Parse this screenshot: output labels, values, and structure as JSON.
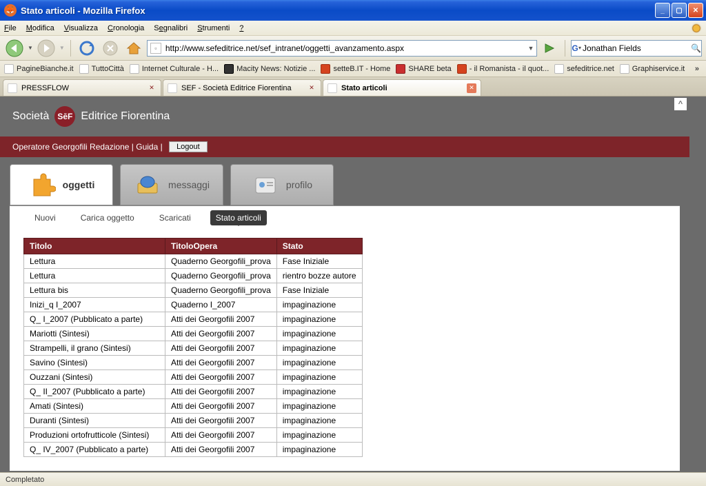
{
  "window": {
    "title": "Stato articoli - Mozilla Firefox"
  },
  "menu": {
    "items": [
      "File",
      "Modifica",
      "Visualizza",
      "Cronologia",
      "Segnalibri",
      "Strumenti",
      "?"
    ]
  },
  "url": "http://www.sefeditrice.net/sef_intranet/oggetti_avanzamento.aspx",
  "search": {
    "engine_letter": "G",
    "value": "Jonathan Fields"
  },
  "bookmarks": [
    "PagineBianche.it",
    "TuttoCittà",
    "Internet Culturale - H...",
    "Macity News: Notizie ...",
    "setteB.IT - Home",
    "SHARE beta",
    "- il Romanista - il quot...",
    "sefeditrice.net",
    "Graphiservice.it"
  ],
  "tabs": [
    {
      "label": "PRESSFLOW",
      "active": false
    },
    {
      "label": "SEF - Società Editrice Fiorentina",
      "active": false
    },
    {
      "label": "Stato articoli",
      "active": true
    }
  ],
  "brand": {
    "pre": "Società",
    "logo": "SēF",
    "post": "Editrice Fiorentina"
  },
  "userbar": {
    "operator": "Operatore Georgofili Redazione",
    "guide": "Guida",
    "logout": "Logout"
  },
  "maintabs": [
    {
      "label": "oggetti",
      "active": true
    },
    {
      "label": "messaggi",
      "active": false
    },
    {
      "label": "profilo",
      "active": false
    }
  ],
  "subtabs": [
    {
      "label": "Nuovi",
      "active": false
    },
    {
      "label": "Carica oggetto",
      "active": false
    },
    {
      "label": "Scaricati",
      "active": false
    },
    {
      "label": "Stato articoli",
      "active": true
    }
  ],
  "table": {
    "headers": [
      "Titolo",
      "TitoloOpera",
      "Stato"
    ],
    "rows": [
      [
        "Lettura",
        "Quaderno Georgofili_prova",
        "Fase Iniziale"
      ],
      [
        "Lettura",
        "Quaderno Georgofili_prova",
        "rientro bozze autore"
      ],
      [
        "Lettura bis",
        "Quaderno Georgofili_prova",
        "Fase Iniziale"
      ],
      [
        "Inizi_q I_2007",
        "Quaderno I_2007",
        "impaginazione"
      ],
      [
        "Q_ I_2007 (Pubblicato a parte)",
        "Atti dei Georgofili 2007",
        "impaginazione"
      ],
      [
        "Mariotti (Sintesi)",
        "Atti dei Georgofili 2007",
        "impaginazione"
      ],
      [
        "Strampelli, il grano (Sintesi)",
        "Atti dei Georgofili 2007",
        "impaginazione"
      ],
      [
        "Savino (Sintesi)",
        "Atti dei Georgofili 2007",
        "impaginazione"
      ],
      [
        "Ouzzani (Sintesi)",
        "Atti dei Georgofili 2007",
        "impaginazione"
      ],
      [
        "Q_ II_2007 (Pubblicato a parte)",
        "Atti dei Georgofili 2007",
        "impaginazione"
      ],
      [
        "Amati (Sintesi)",
        "Atti dei Georgofili 2007",
        "impaginazione"
      ],
      [
        "Duranti (Sintesi)",
        "Atti dei Georgofili 2007",
        "impaginazione"
      ],
      [
        "Produzioni ortofrutticole (Sintesi)",
        "Atti dei Georgofili 2007",
        "impaginazione"
      ],
      [
        "Q_ IV_2007 (Pubblicato a parte)",
        "Atti dei Georgofili 2007",
        "impaginazione"
      ]
    ]
  },
  "status": "Completato"
}
